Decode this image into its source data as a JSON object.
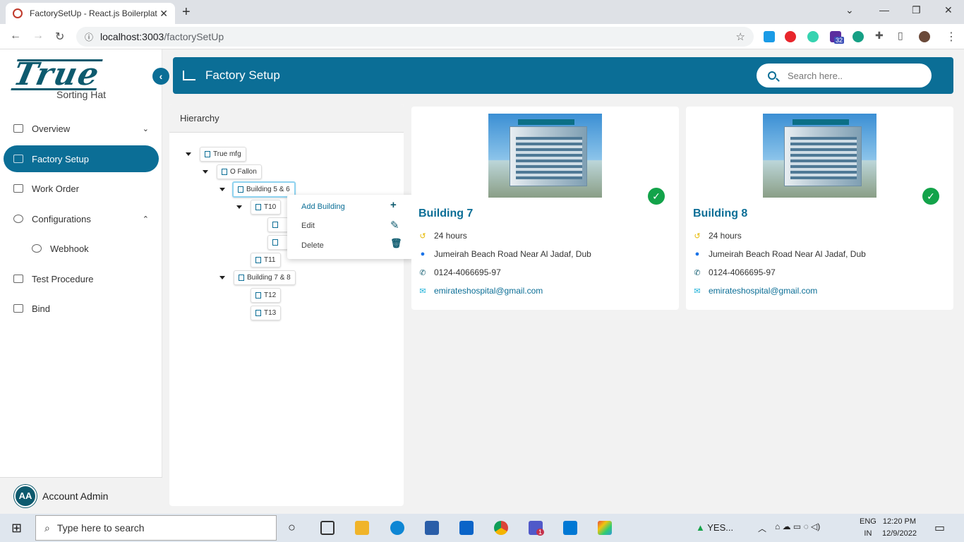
{
  "browser": {
    "tab_title": "FactorySetUp - React.js Boilerplat",
    "url_host": "localhost:3003",
    "url_path": "/factorySetUp",
    "ext_badge": "32"
  },
  "sidebar": {
    "brand": "True",
    "brand_sub": "Sorting Hat",
    "items": [
      {
        "label": "Overview",
        "chev": "⌄"
      },
      {
        "label": "Factory Setup",
        "chev": ""
      },
      {
        "label": "Work Order",
        "chev": ""
      },
      {
        "label": "Configurations",
        "chev": "⌃"
      },
      {
        "label": "Webhook",
        "chev": ""
      },
      {
        "label": "Test Procedure",
        "chev": ""
      },
      {
        "label": "Bind",
        "chev": ""
      }
    ],
    "account_initials": "AA",
    "account_name": "Account Admin"
  },
  "header": {
    "title": "Factory Setup",
    "search_placeholder": "Search here.."
  },
  "hierarchy": {
    "title": "Hierarchy",
    "nodes": [
      "True mfg",
      "O Fallon",
      "Building 5 & 6",
      "T10",
      "T11",
      "Building 7 & 8",
      "T12",
      "T13"
    ]
  },
  "context_menu": {
    "add": "Add Building",
    "edit": "Edit",
    "delete": "Delete"
  },
  "cards": [
    {
      "title": "Building 7",
      "hours": "24 hours",
      "address": "Jumeirah Beach Road Near Al Jadaf, Dub",
      "phone": "0124-4066695-97",
      "email": "emirateshospital@gmail.com"
    },
    {
      "title": "Building 8",
      "hours": "24 hours",
      "address": "Jumeirah Beach Road Near Al Jadaf, Dub",
      "phone": "0124-4066695-97",
      "email": "emirateshospital@gmail.com"
    }
  ],
  "taskbar": {
    "search_placeholder": "Type here to search",
    "weather": "YES...",
    "lang_line1": "ENG",
    "lang_line2": "IN",
    "time": "12:20 PM",
    "date": "12/9/2022",
    "notif_badge": "1"
  },
  "colors": {
    "primary": "#0b6e96",
    "success": "#13a34a",
    "brand": "#0d5a6e"
  }
}
